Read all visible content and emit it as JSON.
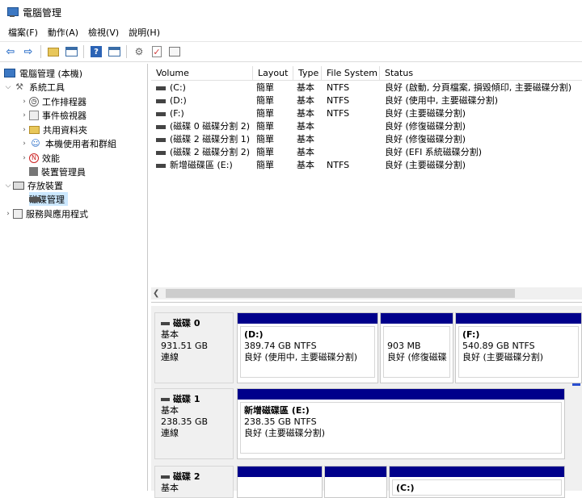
{
  "window": {
    "title": "電腦管理"
  },
  "menu": [
    "檔案(F)",
    "動作(A)",
    "檢視(V)",
    "說明(H)"
  ],
  "toolbar": {
    "back_icon": "back-arrow-icon",
    "forward_icon": "forward-arrow-icon"
  },
  "tree": {
    "root": "電腦管理 (本機)",
    "system_tools": "系統工具",
    "task_scheduler": "工作排程器",
    "event_viewer": "事件檢視器",
    "shared_folders": "共用資料夾",
    "local_users": "本機使用者和群組",
    "performance": "效能",
    "device_manager": "裝置管理員",
    "storage": "存放裝置",
    "disk_management": "磁碟管理",
    "services_apps": "服務與應用程式"
  },
  "volumes": {
    "headers": {
      "volume": "Volume",
      "layout": "Layout",
      "type": "Type",
      "fs": "File System",
      "status": "Status"
    },
    "rows": [
      {
        "volume": "(C:)",
        "layout": "簡單",
        "type": "基本",
        "fs": "NTFS",
        "status": "良好 (啟動, 分頁檔案, 損毀傾印, 主要磁碟分割)"
      },
      {
        "volume": "(D:)",
        "layout": "簡單",
        "type": "基本",
        "fs": "NTFS",
        "status": "良好 (使用中, 主要磁碟分割)"
      },
      {
        "volume": "(F:)",
        "layout": "簡單",
        "type": "基本",
        "fs": "NTFS",
        "status": "良好 (主要磁碟分割)"
      },
      {
        "volume": "(磁碟 0 磁碟分割 2)",
        "layout": "簡單",
        "type": "基本",
        "fs": "",
        "status": "良好 (修復磁碟分割)"
      },
      {
        "volume": "(磁碟 2 磁碟分割 1)",
        "layout": "簡單",
        "type": "基本",
        "fs": "",
        "status": "良好 (修復磁碟分割)"
      },
      {
        "volume": "(磁碟 2 磁碟分割 2)",
        "layout": "簡單",
        "type": "基本",
        "fs": "",
        "status": "良好 (EFI 系統磁碟分割)"
      },
      {
        "volume": "新增磁碟區 (E:)",
        "layout": "簡單",
        "type": "基本",
        "fs": "NTFS",
        "status": "良好 (主要磁碟分割)"
      }
    ]
  },
  "disks": {
    "disk0": {
      "name": "磁碟 0",
      "type": "基本",
      "size": "931.51 GB",
      "state": "連線",
      "p1": {
        "name": "(D:)",
        "size": "389.74 GB NTFS",
        "status": "良好 (使用中, 主要磁碟分割)"
      },
      "p2": {
        "size": "903 MB",
        "status": "良好 (修復磁碟"
      },
      "p3": {
        "name": "(F:)",
        "size": "540.89 GB NTFS",
        "status": "良好 (主要磁碟分割)"
      }
    },
    "disk1": {
      "name": "磁碟 1",
      "type": "基本",
      "size": "238.35 GB",
      "state": "連線",
      "p1": {
        "name": "新增磁碟區 (E:)",
        "size": "238.35 GB NTFS",
        "status": "良好 (主要磁碟分割)"
      }
    },
    "disk2": {
      "name": "磁碟 2",
      "type": "基本",
      "p3": {
        "name": "(C:)"
      }
    }
  }
}
